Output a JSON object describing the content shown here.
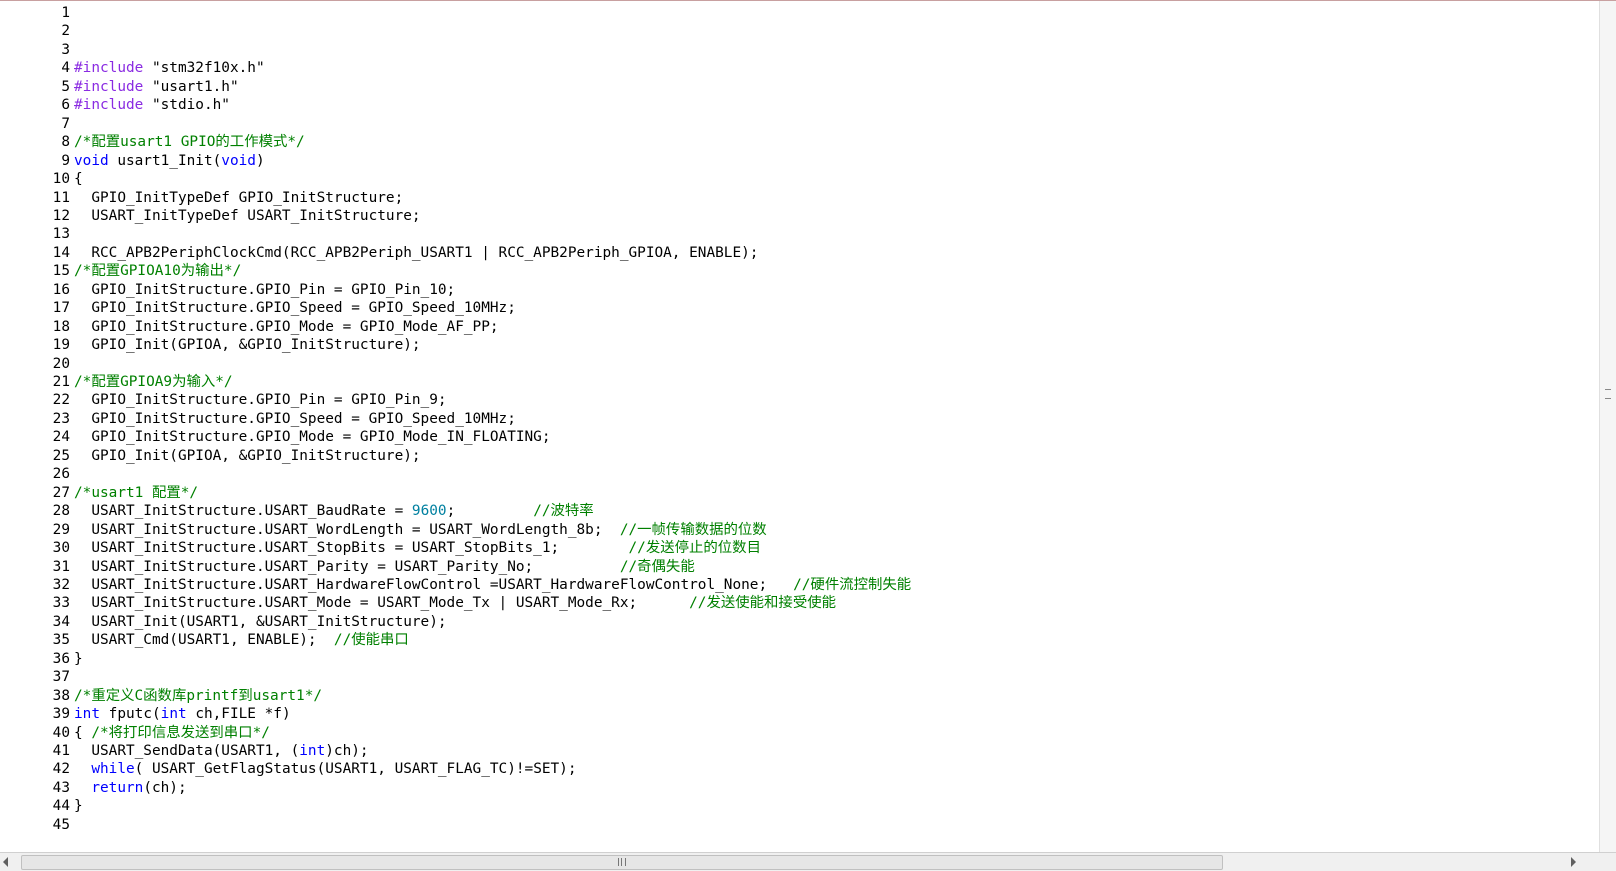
{
  "editor": {
    "lines": [
      {
        "n": "1",
        "tokens": []
      },
      {
        "n": "2",
        "tokens": []
      },
      {
        "n": "3",
        "tokens": []
      },
      {
        "n": "4",
        "tokens": [
          [
            "pp",
            "#include "
          ],
          [
            "str",
            "\"stm32f10x.h\""
          ]
        ]
      },
      {
        "n": "5",
        "tokens": [
          [
            "pp",
            "#include "
          ],
          [
            "str",
            "\"usart1.h\""
          ]
        ]
      },
      {
        "n": "6",
        "tokens": [
          [
            "pp",
            "#include "
          ],
          [
            "str",
            "\"stdio.h\""
          ]
        ]
      },
      {
        "n": "7",
        "tokens": []
      },
      {
        "n": "8",
        "tokens": [
          [
            "cm",
            "/*配置usart1 GPIO的工作模式*/"
          ]
        ]
      },
      {
        "n": "9",
        "tokens": [
          [
            "kw",
            "void"
          ],
          [
            "pl",
            " usart1_Init("
          ],
          [
            "kw",
            "void"
          ],
          [
            "pl",
            ")"
          ]
        ]
      },
      {
        "n": "10",
        "tokens": [
          [
            "pl",
            "{"
          ]
        ]
      },
      {
        "n": "11",
        "tokens": [
          [
            "pl",
            "  GPIO_InitTypeDef GPIO_InitStructure;"
          ]
        ]
      },
      {
        "n": "12",
        "tokens": [
          [
            "pl",
            "  USART_InitTypeDef USART_InitStructure;"
          ]
        ]
      },
      {
        "n": "13",
        "tokens": []
      },
      {
        "n": "14",
        "tokens": [
          [
            "pl",
            "  RCC_APB2PeriphClockCmd(RCC_APB2Periph_USART1 | RCC_APB2Periph_GPIOA, ENABLE);"
          ]
        ]
      },
      {
        "n": "15",
        "tokens": [
          [
            "cm",
            "/*配置GPIOA10为输出*/"
          ]
        ]
      },
      {
        "n": "16",
        "tokens": [
          [
            "pl",
            "  GPIO_InitStructure.GPIO_Pin = GPIO_Pin_10;"
          ]
        ]
      },
      {
        "n": "17",
        "tokens": [
          [
            "pl",
            "  GPIO_InitStructure.GPIO_Speed = GPIO_Speed_10MHz;"
          ]
        ]
      },
      {
        "n": "18",
        "tokens": [
          [
            "pl",
            "  GPIO_InitStructure.GPIO_Mode = GPIO_Mode_AF_PP;"
          ]
        ]
      },
      {
        "n": "19",
        "tokens": [
          [
            "pl",
            "  GPIO_Init(GPIOA, &GPIO_InitStructure);"
          ]
        ]
      },
      {
        "n": "20",
        "tokens": []
      },
      {
        "n": "21",
        "tokens": [
          [
            "cm",
            "/*配置GPIOA9为输入*/"
          ]
        ]
      },
      {
        "n": "22",
        "tokens": [
          [
            "pl",
            "  GPIO_InitStructure.GPIO_Pin = GPIO_Pin_9;"
          ]
        ]
      },
      {
        "n": "23",
        "tokens": [
          [
            "pl",
            "  GPIO_InitStructure.GPIO_Speed = GPIO_Speed_10MHz;"
          ]
        ]
      },
      {
        "n": "24",
        "tokens": [
          [
            "pl",
            "  GPIO_InitStructure.GPIO_Mode = GPIO_Mode_IN_FLOATING;"
          ]
        ]
      },
      {
        "n": "25",
        "tokens": [
          [
            "pl",
            "  GPIO_Init(GPIOA, &GPIO_InitStructure);"
          ]
        ]
      },
      {
        "n": "26",
        "tokens": []
      },
      {
        "n": "27",
        "tokens": [
          [
            "cm",
            "/*usart1 配置*/"
          ]
        ]
      },
      {
        "n": "28",
        "tokens": [
          [
            "pl",
            "  USART_InitStructure.USART_BaudRate = "
          ],
          [
            "num",
            "9600"
          ],
          [
            "pl",
            ";         "
          ],
          [
            "cm",
            "//波特率"
          ]
        ]
      },
      {
        "n": "29",
        "tokens": [
          [
            "pl",
            "  USART_InitStructure.USART_WordLength = USART_WordLength_8b;  "
          ],
          [
            "cm",
            "//一帧传输数据的位数"
          ]
        ]
      },
      {
        "n": "30",
        "tokens": [
          [
            "pl",
            "  USART_InitStructure.USART_StopBits = USART_StopBits_1;        "
          ],
          [
            "cm",
            "//发送停止的位数目"
          ]
        ]
      },
      {
        "n": "31",
        "tokens": [
          [
            "pl",
            "  USART_InitStructure.USART_Parity = USART_Parity_No;          "
          ],
          [
            "cm",
            "//奇偶失能"
          ]
        ]
      },
      {
        "n": "32",
        "tokens": [
          [
            "pl",
            "  USART_InitStructure.USART_HardwareFlowControl =USART_HardwareFlowControl_None;   "
          ],
          [
            "cm",
            "//硬件流控制失能"
          ]
        ]
      },
      {
        "n": "33",
        "tokens": [
          [
            "pl",
            "  USART_InitStructure.USART_Mode = USART_Mode_Tx | USART_Mode_Rx;      "
          ],
          [
            "cm",
            "//发送使能和接受使能"
          ]
        ]
      },
      {
        "n": "34",
        "tokens": [
          [
            "pl",
            "  USART_Init(USART1, &USART_InitStructure);"
          ]
        ]
      },
      {
        "n": "35",
        "tokens": [
          [
            "pl",
            "  USART_Cmd(USART1, ENABLE);  "
          ],
          [
            "cm",
            "//使能串口"
          ]
        ]
      },
      {
        "n": "36",
        "tokens": [
          [
            "pl",
            "}"
          ]
        ]
      },
      {
        "n": "37",
        "tokens": []
      },
      {
        "n": "38",
        "tokens": [
          [
            "cm",
            "/*重定义C函数库printf到usart1*/"
          ]
        ]
      },
      {
        "n": "39",
        "tokens": [
          [
            "kw",
            "int"
          ],
          [
            "pl",
            " fputc("
          ],
          [
            "kw",
            "int"
          ],
          [
            "pl",
            " ch,FILE *f)"
          ]
        ]
      },
      {
        "n": "40",
        "tokens": [
          [
            "pl",
            "{ "
          ],
          [
            "cm",
            "/*将打印信息发送到串口*/"
          ]
        ]
      },
      {
        "n": "41",
        "tokens": [
          [
            "pl",
            "  USART_SendData(USART1, ("
          ],
          [
            "kw",
            "int"
          ],
          [
            "pl",
            ")ch);"
          ]
        ]
      },
      {
        "n": "42",
        "tokens": [
          [
            "pl",
            "  "
          ],
          [
            "kw",
            "while"
          ],
          [
            "pl",
            "( USART_GetFlagStatus(USART1, USART_FLAG_TC)!=SET);"
          ]
        ]
      },
      {
        "n": "43",
        "tokens": [
          [
            "pl",
            "  "
          ],
          [
            "kw",
            "return"
          ],
          [
            "pl",
            "(ch);"
          ]
        ]
      },
      {
        "n": "44",
        "tokens": [
          [
            "pl",
            "}"
          ]
        ]
      },
      {
        "n": "45",
        "tokens": []
      }
    ]
  },
  "colors": {
    "preprocessor": "#8a2be2",
    "keyword": "#0000ff",
    "comment": "#008000",
    "number": "#0080a0",
    "text": "#000000"
  },
  "icons": {
    "scroll_left": "triangle-left-icon",
    "scroll_right": "triangle-right-icon",
    "grip": "grip-icon"
  }
}
